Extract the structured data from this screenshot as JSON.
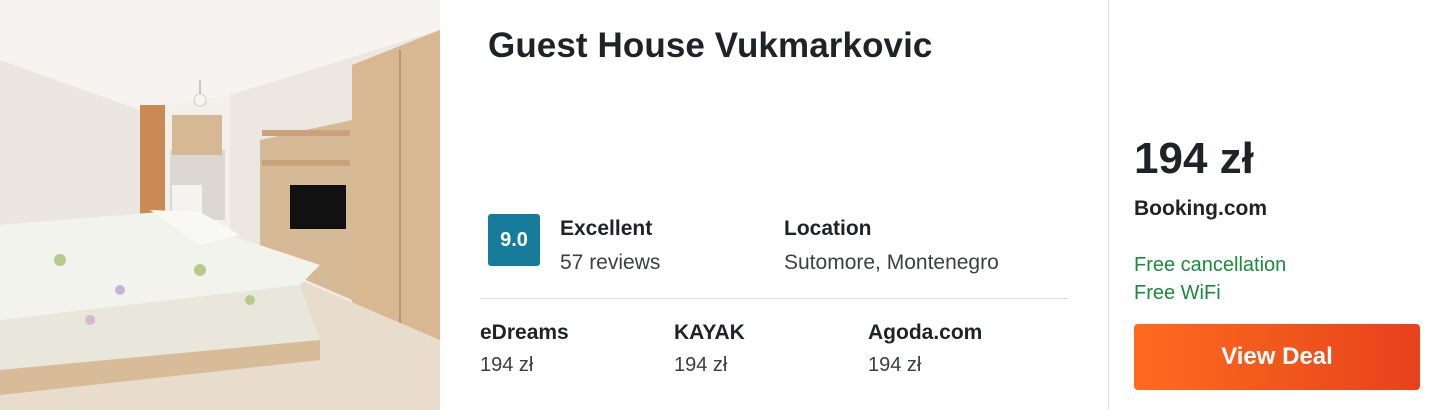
{
  "listing": {
    "name": "Guest House Vukmarkovic",
    "score": "9.0",
    "rating_label": "Excellent",
    "reviews": "57 reviews",
    "location_label": "Location",
    "location_value": "Sutomore, Montenegro",
    "score_color": "#167c99"
  },
  "providers": [
    {
      "name": "eDreams",
      "price": "194 zł"
    },
    {
      "name": "KAYAK",
      "price": "194 zł"
    },
    {
      "name": "Agoda.com",
      "price": "194 zł"
    }
  ],
  "deal": {
    "price": "194 zł",
    "provider": "Booking.com",
    "features": [
      "Free cancellation",
      "Free WiFi"
    ],
    "feature_color": "#1a8a3b",
    "button_label": "View Deal",
    "button_color": "#f0561c"
  }
}
